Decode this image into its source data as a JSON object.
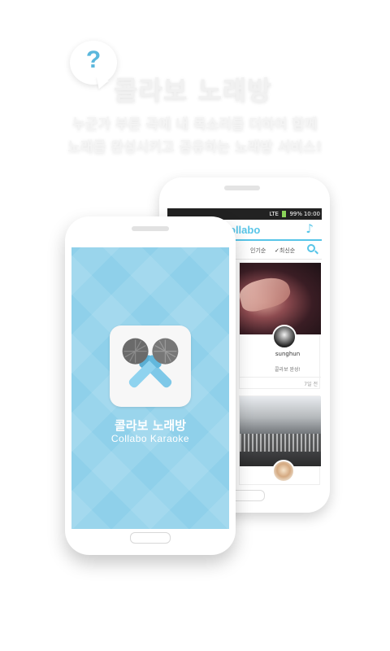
{
  "hero": {
    "bubble_symbol": "?",
    "title": "콜라보 노래방",
    "tagline_line1": "누군가 부른 곡에 내 목소리를 더하여 함께",
    "tagline_line2": "노래를 완성시키고 공유하는 노래방 서비스!"
  },
  "back_phone": {
    "status_bar": {
      "signal_label": "LTE",
      "battery": "99%",
      "time": "10:00"
    },
    "app_bar": {
      "brand": "ollabo",
      "music_icon": "music-note-icon"
    },
    "tabs": {
      "popular": "인기순",
      "recent_check": "✓",
      "recent": "최신순",
      "search_icon": "search-icon"
    },
    "feed": [
      {
        "username": "sunghun",
        "caption": "콜라보 완성!",
        "date": "7일 전"
      },
      {
        "username": "",
        "caption": "",
        "date": ""
      }
    ]
  },
  "front_phone": {
    "splash": {
      "title": "콜라보 노래방",
      "subtitle": "Collabo Karaoke",
      "icon": "crossed-microphones-icon"
    }
  },
  "colors": {
    "accent": "#58c5e8",
    "splash_bg": "#8fd0ea",
    "mic_handle": "#7ec8e8",
    "mic_head": "#6a6a6a"
  }
}
